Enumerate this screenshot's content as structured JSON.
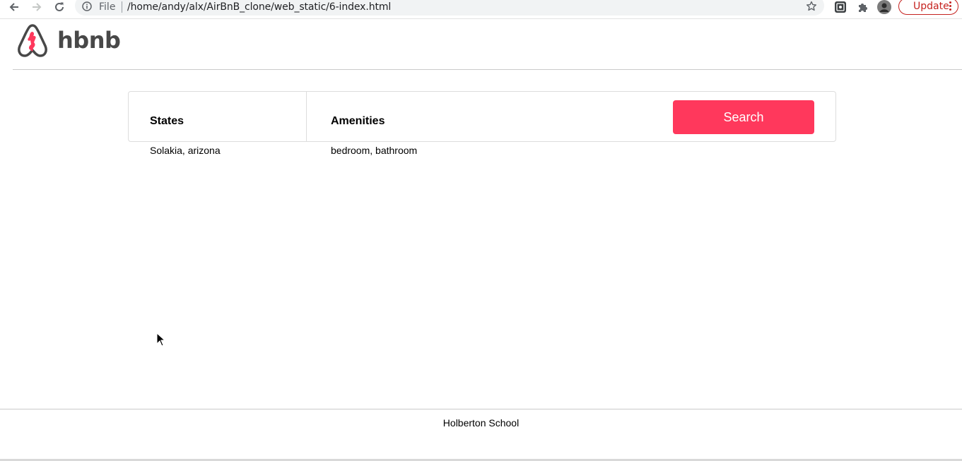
{
  "browser": {
    "scheme_label": "File",
    "url": "/home/andy/alx/AirBnB_clone/web_static/6-index.html",
    "update_label": "Update",
    "icons": [
      "back-arrow-icon",
      "forward-arrow-icon",
      "reload-icon",
      "info-icon",
      "star-icon",
      "extension-icon",
      "puzzle-icon",
      "profile-avatar"
    ]
  },
  "header": {
    "logo_text": "hbnb",
    "logo_color": "#ff385c"
  },
  "filters": {
    "states_title": "States",
    "states_value": "Solakia, arizona",
    "amenities_title": "Amenities",
    "amenities_value": "bedroom, bathroom",
    "search_label": "Search",
    "search_color": "#ff385c"
  },
  "footer": {
    "text": "Holberton School"
  }
}
